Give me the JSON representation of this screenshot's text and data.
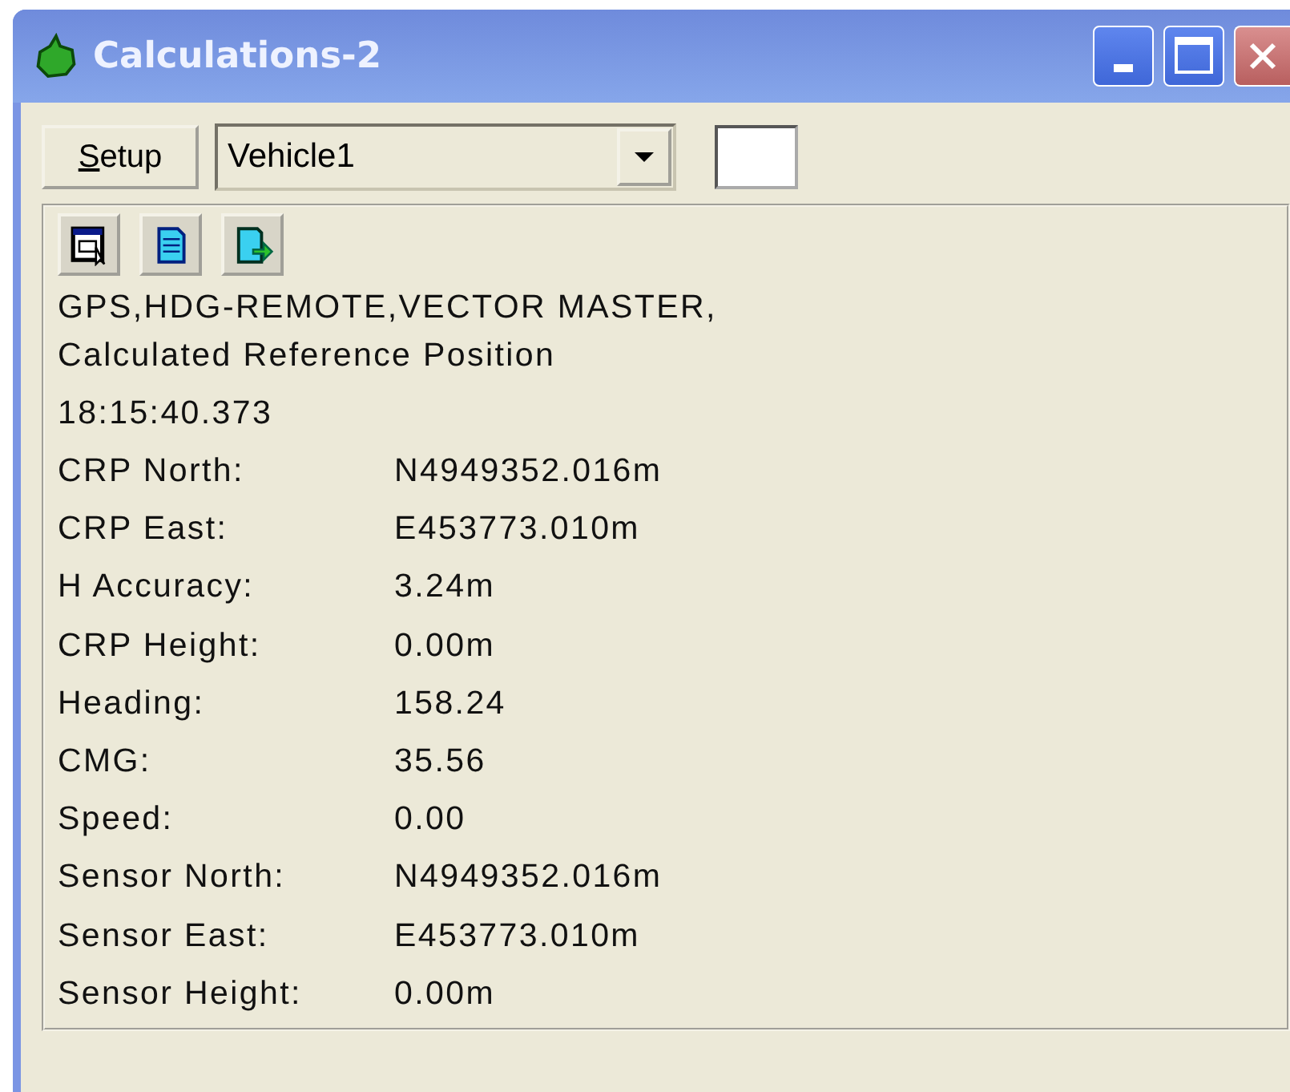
{
  "window": {
    "title": "Calculations-2"
  },
  "toolbar": {
    "setup_button": "Setup",
    "vehicle_dropdown": {
      "value": "Vehicle1"
    }
  },
  "header_lines": [
    "GPS,HDG-REMOTE,VECTOR MASTER,",
    "Calculated Reference Position"
  ],
  "time": "18:15:40.373",
  "rows": [
    {
      "label": "CRP North:",
      "value": "N4949352.016m"
    },
    {
      "label": "CRP East:",
      "value": "E453773.010m"
    },
    {
      "label": "H Accuracy:",
      "value": "3.24m"
    },
    {
      "label": "CRP Height:",
      "value": "0.00m"
    },
    {
      "label": "Heading:",
      "value": "158.24"
    },
    {
      "label": "CMG:",
      "value": "35.56"
    },
    {
      "label": "Speed:",
      "value": "0.00"
    },
    {
      "label": "Sensor North:",
      "value": "N4949352.016m"
    },
    {
      "label": "Sensor East:",
      "value": "E453773.010m"
    },
    {
      "label": "Sensor Height:",
      "value": "0.00m"
    }
  ]
}
